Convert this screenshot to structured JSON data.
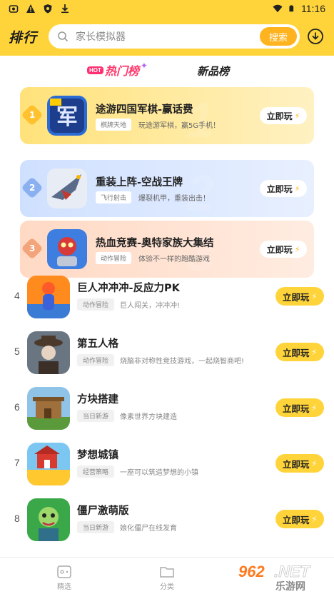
{
  "statusbar": {
    "time": "11:16"
  },
  "header": {
    "title": "排行",
    "search_placeholder": "家长模拟器",
    "search_button": "搜索"
  },
  "tabs": {
    "hot_badge": "HOT",
    "hot_label": "热门榜",
    "new_label": "新品榜"
  },
  "top_cards": [
    {
      "rank": "1",
      "name": "途游四国军棋-赢话费",
      "tag": "棋牌天地",
      "desc": "玩途游军棋，赢5G手机！",
      "play": "立即玩"
    },
    {
      "rank": "2",
      "name": "重装上阵-空战王牌",
      "tag": "飞行射击",
      "desc": "爆裂机甲，重装出击！",
      "play": "立即玩"
    },
    {
      "rank": "3",
      "name": "热血竞赛-奥特家族大集结",
      "tag": "动作冒险",
      "desc": "体验不一样的跑酷游戏",
      "play": "立即玩"
    }
  ],
  "list": [
    {
      "rank": "4",
      "name": "巨人冲冲冲-反应力PK",
      "tag": "动作冒险",
      "desc": "巨人闯关，冲冲冲!",
      "play": "立即玩"
    },
    {
      "rank": "5",
      "name": "第五人格",
      "tag": "动作冒险",
      "desc": "烧脑非对称性竞技游戏，一起烧智商吧!",
      "play": "立即玩"
    },
    {
      "rank": "6",
      "name": "方块搭建",
      "tag": "当日新游",
      "desc": "像素世界方块建造",
      "play": "立即玩"
    },
    {
      "rank": "7",
      "name": "梦想城镇",
      "tag": "经营策略",
      "desc": "一座可以筑造梦想的小镇",
      "play": "立即玩"
    },
    {
      "rank": "8",
      "name": "僵尸激萌版",
      "tag": "当日新游",
      "desc": "娘化僵尸在线发育",
      "play": "立即玩"
    }
  ],
  "bottomnav": {
    "item1": "精选",
    "item2": "分类"
  },
  "watermark": {
    "brand": "962.NET",
    "sub": "乐游网"
  }
}
